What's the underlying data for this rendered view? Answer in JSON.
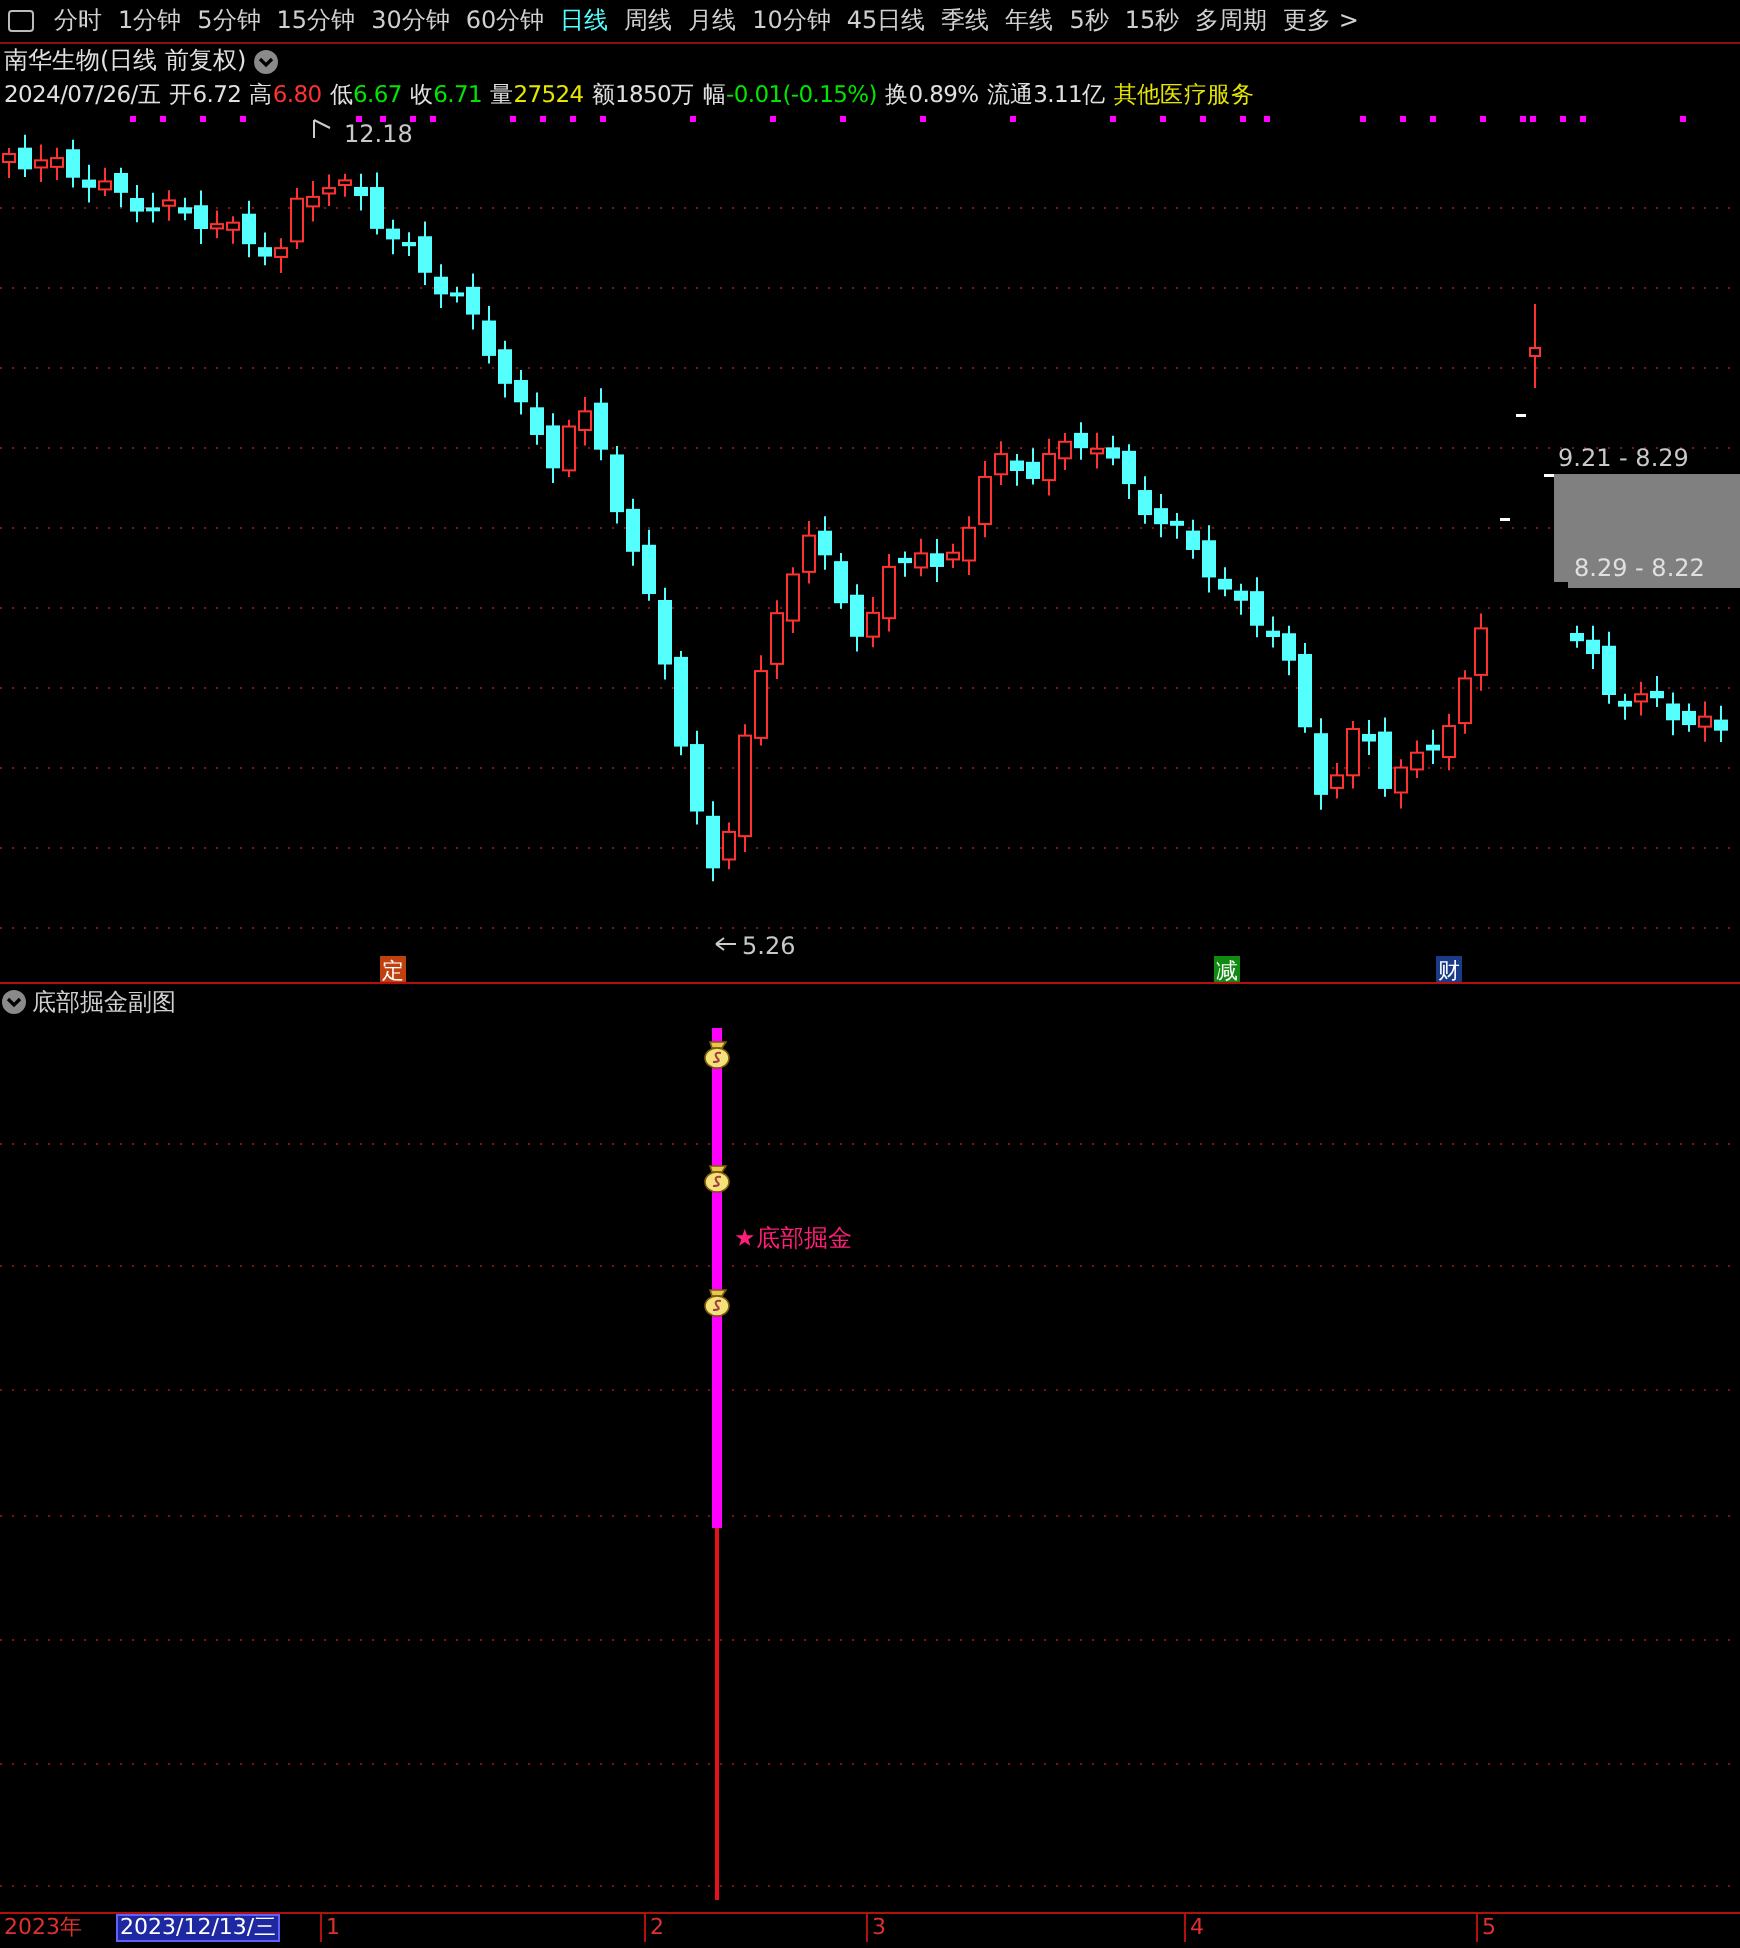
{
  "toolbar": {
    "periods": [
      {
        "label": "分时",
        "selected": false
      },
      {
        "label": "1分钟",
        "selected": false
      },
      {
        "label": "5分钟",
        "selected": false
      },
      {
        "label": "15分钟",
        "selected": false
      },
      {
        "label": "30分钟",
        "selected": false
      },
      {
        "label": "60分钟",
        "selected": false
      },
      {
        "label": "日线",
        "selected": true
      },
      {
        "label": "周线",
        "selected": false
      },
      {
        "label": "月线",
        "selected": false
      },
      {
        "label": "10分钟",
        "selected": false
      },
      {
        "label": "45日线",
        "selected": false
      },
      {
        "label": "季线",
        "selected": false
      },
      {
        "label": "年线",
        "selected": false
      },
      {
        "label": "5秒",
        "selected": false
      },
      {
        "label": "15秒",
        "selected": false
      },
      {
        "label": "多周期",
        "selected": false
      }
    ],
    "more": "更多 >"
  },
  "title": "南华生物(日线 前复权)",
  "quote": [
    {
      "label": "2024/07/26/五",
      "color": "#e0e0e0"
    },
    {
      "label": "开",
      "value": "6.72",
      "color": "#e0e0e0"
    },
    {
      "label": "高",
      "value": "6.80",
      "color": "#ff3232"
    },
    {
      "label": "低",
      "value": "6.67",
      "color": "#00e600"
    },
    {
      "label": "收",
      "value": "6.71",
      "color": "#00e600"
    },
    {
      "label": "量",
      "value": "27524",
      "color": "#e6e600"
    },
    {
      "label": "额",
      "value": "1850万",
      "color": "#e0e0e0"
    },
    {
      "label": "幅",
      "value": "-0.01(-0.15%)",
      "color": "#00e600"
    },
    {
      "label": "换",
      "value": "0.89%",
      "color": "#e0e0e0"
    },
    {
      "label": "流通",
      "value": "3.11亿",
      "color": "#e0e0e0"
    },
    {
      "label": "其他医疗服务",
      "color": "#e6e600"
    }
  ],
  "chart": {
    "high_label": "12.18",
    "low_label": "5.26",
    "ranges": [
      "9.21 - 8.29",
      "8.29 - 8.22"
    ],
    "events": [
      {
        "text": "定",
        "color": "#c04010"
      },
      {
        "text": "减",
        "color": "#108a10"
      },
      {
        "text": "财",
        "color": "#1a3c88"
      }
    ]
  },
  "subchart": {
    "title": "底部掘金副图",
    "signal": "★底部掘金"
  },
  "axis": {
    "year": "2023年",
    "cursor_date": "2023/12/13/三",
    "months": [
      "1",
      "2",
      "3",
      "4",
      "5"
    ]
  }
}
